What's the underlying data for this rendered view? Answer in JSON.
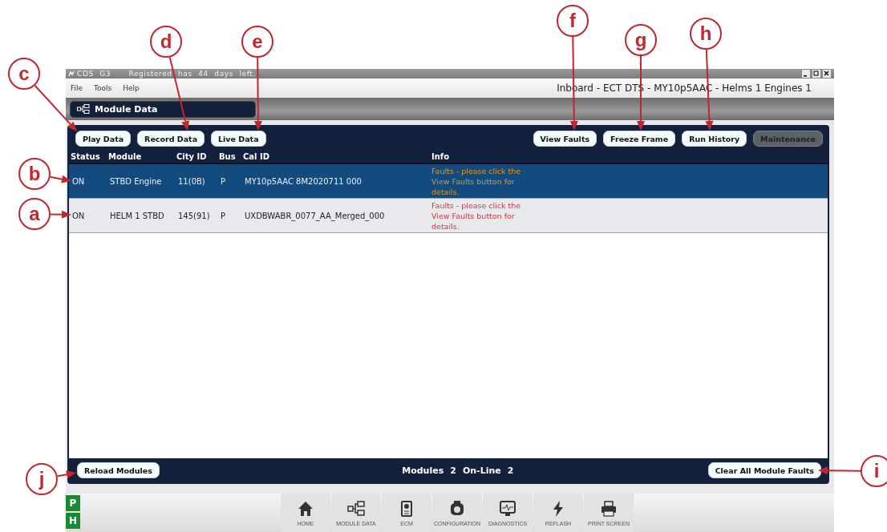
{
  "window": {
    "title": "CDS G3   Registered has 44 days left."
  },
  "menu": [
    "File",
    "Tools",
    "Help"
  ],
  "vessel_info": "Inboard - ECT DTS - MY10p5AAC - Helms 1 Engines 1",
  "tab": {
    "label": "Module Data"
  },
  "left_buttons": [
    {
      "label": "Play Data",
      "disabled": false
    },
    {
      "label": "Record Data",
      "disabled": false
    },
    {
      "label": "Live Data",
      "disabled": false
    }
  ],
  "right_buttons": [
    {
      "label": "View Faults",
      "disabled": false
    },
    {
      "label": "Freeze Frame",
      "disabled": false
    },
    {
      "label": "Run History",
      "disabled": false
    },
    {
      "label": "Maintenance",
      "disabled": true
    }
  ],
  "table": {
    "columns": [
      "Status",
      "Module",
      "City ID",
      "Bus",
      "Cal ID",
      "Info"
    ],
    "rows": [
      {
        "selected": true,
        "cells": [
          "ON",
          "STBD Engine",
          "11(0B)",
          "P",
          "MY10p5AAC 8M2020711 000",
          "Faults - please click the View Faults button for details."
        ]
      },
      {
        "selected": false,
        "cells": [
          "ON",
          "HELM 1 STBD",
          "145(91)",
          "P",
          "UXDBWABR_0077_AA_Merged_000",
          "Faults - please click the View Faults button for details."
        ]
      }
    ]
  },
  "footer": {
    "reload_button": "Reload Modules",
    "modules_label": "Modules",
    "modules_count": "2",
    "online_label": "On-Line",
    "online_count": "2",
    "clear_button": "Clear All Module Faults"
  },
  "status_keys": [
    "P",
    "H"
  ],
  "toolbar": [
    {
      "kind": "home",
      "label": "HOME"
    },
    {
      "kind": "module",
      "label": "MODULE DATA"
    },
    {
      "kind": "ecm",
      "label": "ECM"
    },
    {
      "kind": "config",
      "label": "CONFIGURATION"
    },
    {
      "kind": "diag",
      "label": "DIAGNOSTICS"
    },
    {
      "kind": "flash",
      "label": "REFLASH"
    },
    {
      "kind": "print",
      "label": "PRINT SCREEN"
    }
  ],
  "callouts": [
    {
      "letter": "f"
    },
    {
      "letter": "h"
    },
    {
      "letter": "d"
    },
    {
      "letter": "e"
    },
    {
      "letter": "g"
    },
    {
      "letter": "c"
    },
    {
      "letter": "b"
    },
    {
      "letter": "a"
    },
    {
      "letter": "i"
    },
    {
      "letter": "j"
    }
  ]
}
